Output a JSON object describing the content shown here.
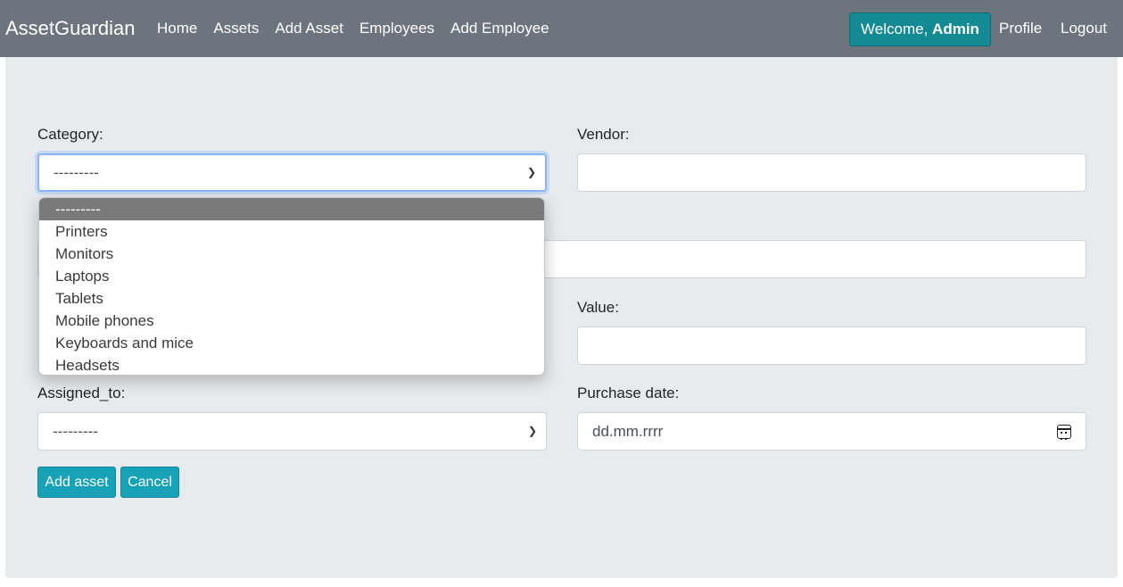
{
  "navbar": {
    "brand": "AssetGuardian",
    "links": [
      "Home",
      "Assets",
      "Add Asset",
      "Employees",
      "Add Employee"
    ],
    "welcome_prefix": "Welcome,",
    "welcome_user": "Admin",
    "profile": "Profile",
    "logout": "Logout"
  },
  "form": {
    "category_label": "Category:",
    "category_value": "---------",
    "vendor_label": "Vendor:",
    "vendor_value": "",
    "value_label": "Value:",
    "value_value": "",
    "assigned_label": "Assigned_to:",
    "assigned_value": "---------",
    "purchase_label": "Purchase date:",
    "purchase_placeholder": "dd.mm.rrrr",
    "add_button": "Add asset",
    "cancel_button": "Cancel"
  },
  "category_options": [
    "---------",
    "Printers",
    "Monitors",
    "Laptops",
    "Tablets",
    "Mobile phones",
    "Keyboards and mice",
    "Headsets"
  ],
  "colors": {
    "navbar": "#6c757d",
    "accent": "#17a2b8",
    "welcome": "#148a94",
    "background": "#e8ebee"
  }
}
